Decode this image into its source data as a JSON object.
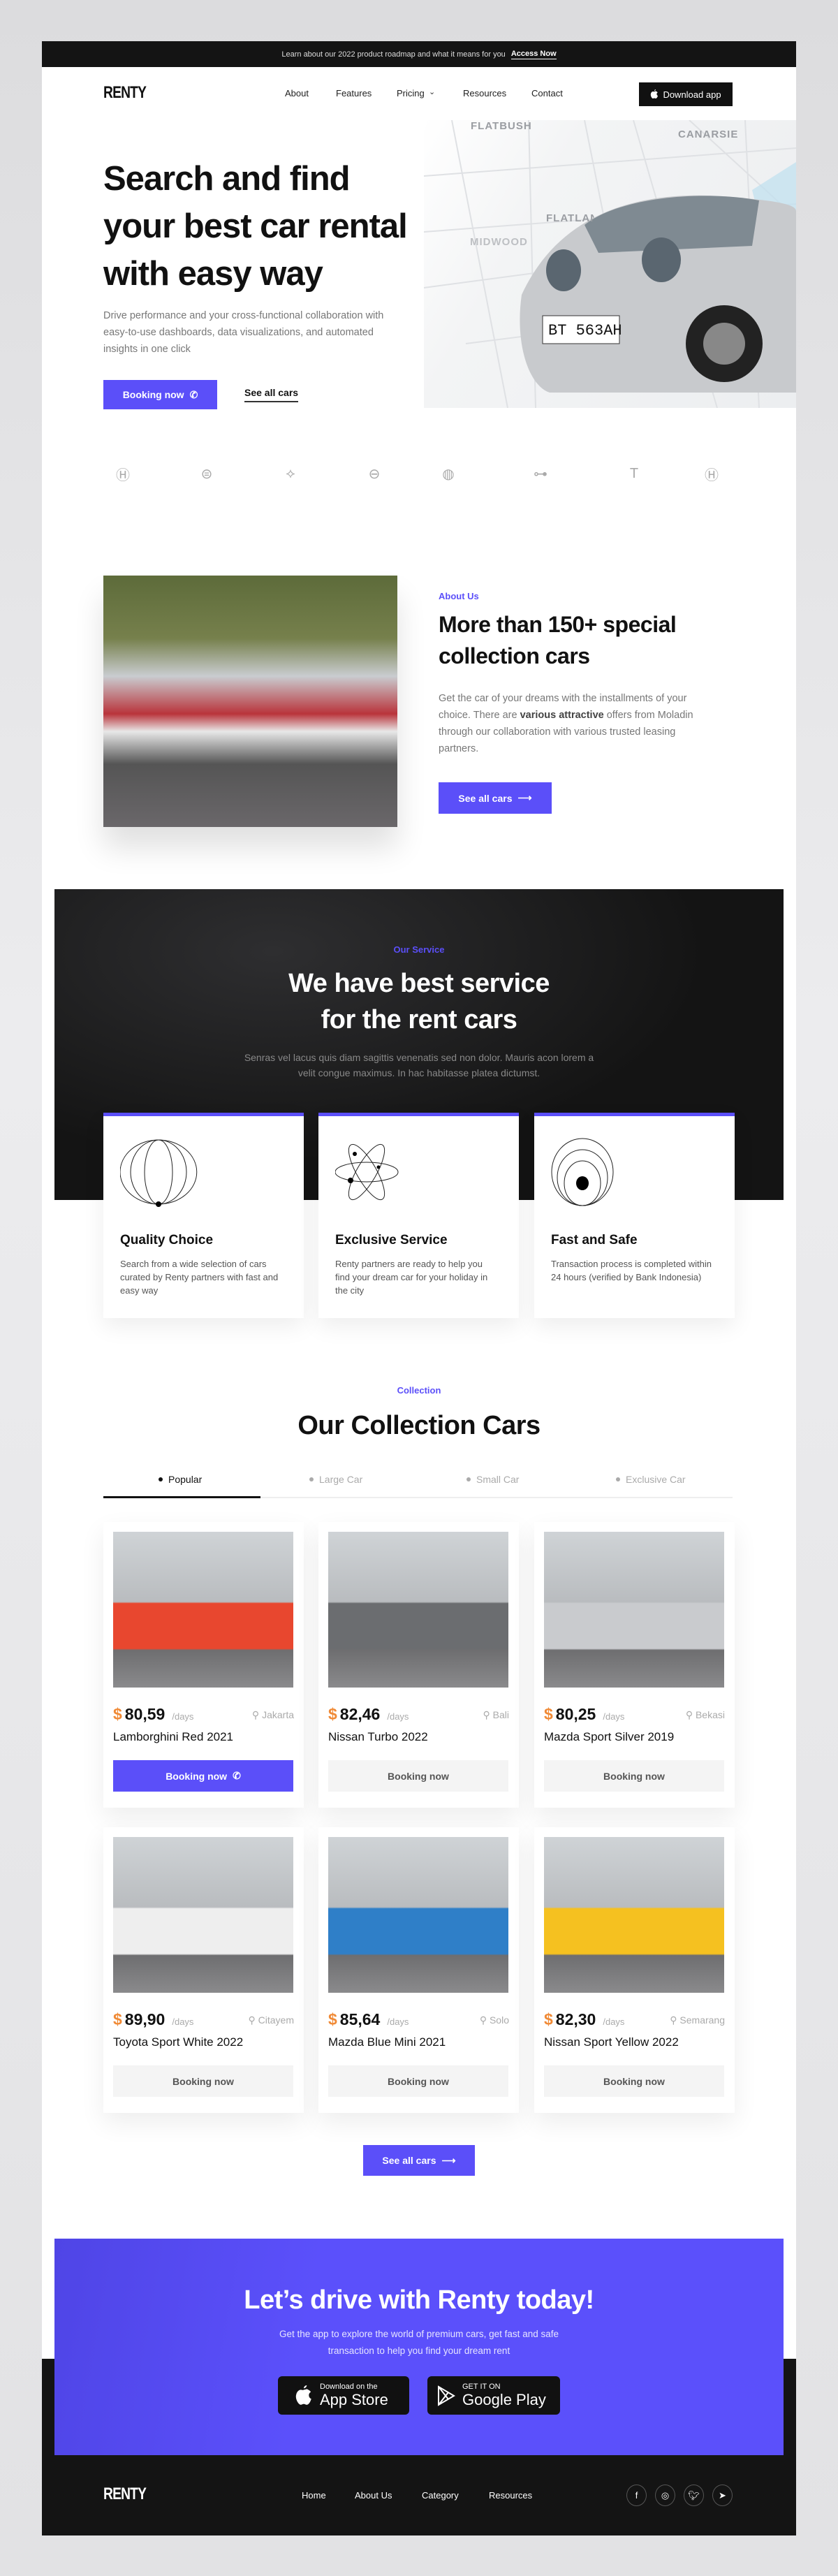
{
  "announcement": {
    "text": "Learn about our 2022 product roadmap and what it means for you",
    "link": "Access Now"
  },
  "nav": {
    "logo": "RENTY",
    "items": [
      "About",
      "Features",
      "Pricing",
      "Resources",
      "Contact"
    ],
    "download": "Download app"
  },
  "hero": {
    "title_lines": [
      "Search and find",
      "your best car rental",
      "with easy way"
    ],
    "description": "Drive performance and your cross-functional collaboration with easy-to-use dashboards, data visualizations, and automated insights in one click",
    "booking": "Booking now",
    "see_all": "See all cars",
    "map_labels": [
      "FLATBUSH",
      "CANARSIE",
      "FLATLANDS",
      "MIDWOOD"
    ],
    "plate": "BT 563AH"
  },
  "brands": [
    "honda-logo",
    "toyota-logo",
    "mitsubishi-logo",
    "nissan-logo",
    "bmw-logo",
    "mini-logo",
    "tesla-logo",
    "hyundai-logo"
  ],
  "about": {
    "label": "About Us",
    "title_lines": [
      "More than 150+ special",
      "collection cars"
    ],
    "text_before": "Get the car of your dreams with the installments of your choice. There are ",
    "text_bold": "various attractive",
    "text_after": " offers from Moladin through our collaboration with various trusted leasing partners.",
    "button": "See all cars"
  },
  "service": {
    "label": "Our Service",
    "title_lines": [
      "We have best service",
      "for the rent cars"
    ],
    "description": "Senras vel lacus quis diam sagittis venenatis sed non dolor. Mauris acon lorem a velit congue maximus. In hac habitasse platea dictumst.",
    "cards": [
      {
        "title": "Quality Choice",
        "text": "Search from a wide selection of cars curated by Renty partners with fast and easy way"
      },
      {
        "title": "Exclusive Service",
        "text": "Renty partners are ready to help you find your dream car for your holiday in the city"
      },
      {
        "title": "Fast and Safe",
        "text": "Transaction process is completed within 24 hours (verified by Bank Indonesia)"
      }
    ]
  },
  "collection": {
    "label": "Collection",
    "title": "Our Collection Cars",
    "tabs": [
      "Popular",
      "Large Car",
      "Small Car",
      "Exclusive Car"
    ],
    "active_tab": 0,
    "currency": "$",
    "per": "/days",
    "booking": "Booking now",
    "cars": [
      {
        "price": "80,59",
        "location": "Jakarta",
        "name": "Lamborghini Red 2021",
        "color": "#e8472f"
      },
      {
        "price": "82,46",
        "location": "Bali",
        "name": "Nissan Turbo 2022",
        "color": "#6b6d70"
      },
      {
        "price": "80,25",
        "location": "Bekasi",
        "name": "Mazda Sport Silver 2019",
        "color": "#c9cbce"
      },
      {
        "price": "89,90",
        "location": "Citayem",
        "name": "Toyota Sport White 2022",
        "color": "#eeeeee"
      },
      {
        "price": "85,64",
        "location": "Solo",
        "name": "Mazda Blue Mini 2021",
        "color": "#2f7fc8"
      },
      {
        "price": "82,30",
        "location": "Semarang",
        "name": "Nissan Sport Yellow 2022",
        "color": "#f5c120"
      }
    ],
    "see_all": "See all cars"
  },
  "cta": {
    "title": "Let’s drive with Renty today!",
    "description": "Get the app to explore the world of premium cars, get fast and safe transaction to help you find your dream rent",
    "appstore_small": "Download on the",
    "appstore_big": "App Store",
    "google_small": "GET IT ON",
    "google_big": "Google Play"
  },
  "footer": {
    "logo": "RENTY",
    "links": [
      "Home",
      "About Us",
      "Category",
      "Resources"
    ],
    "socials": [
      "facebook-icon",
      "instagram-icon",
      "twitter-icon",
      "telegram-icon"
    ]
  },
  "colors": {
    "accent": "#5b4ff9",
    "price": "#f08a36",
    "dark": "#141414"
  }
}
